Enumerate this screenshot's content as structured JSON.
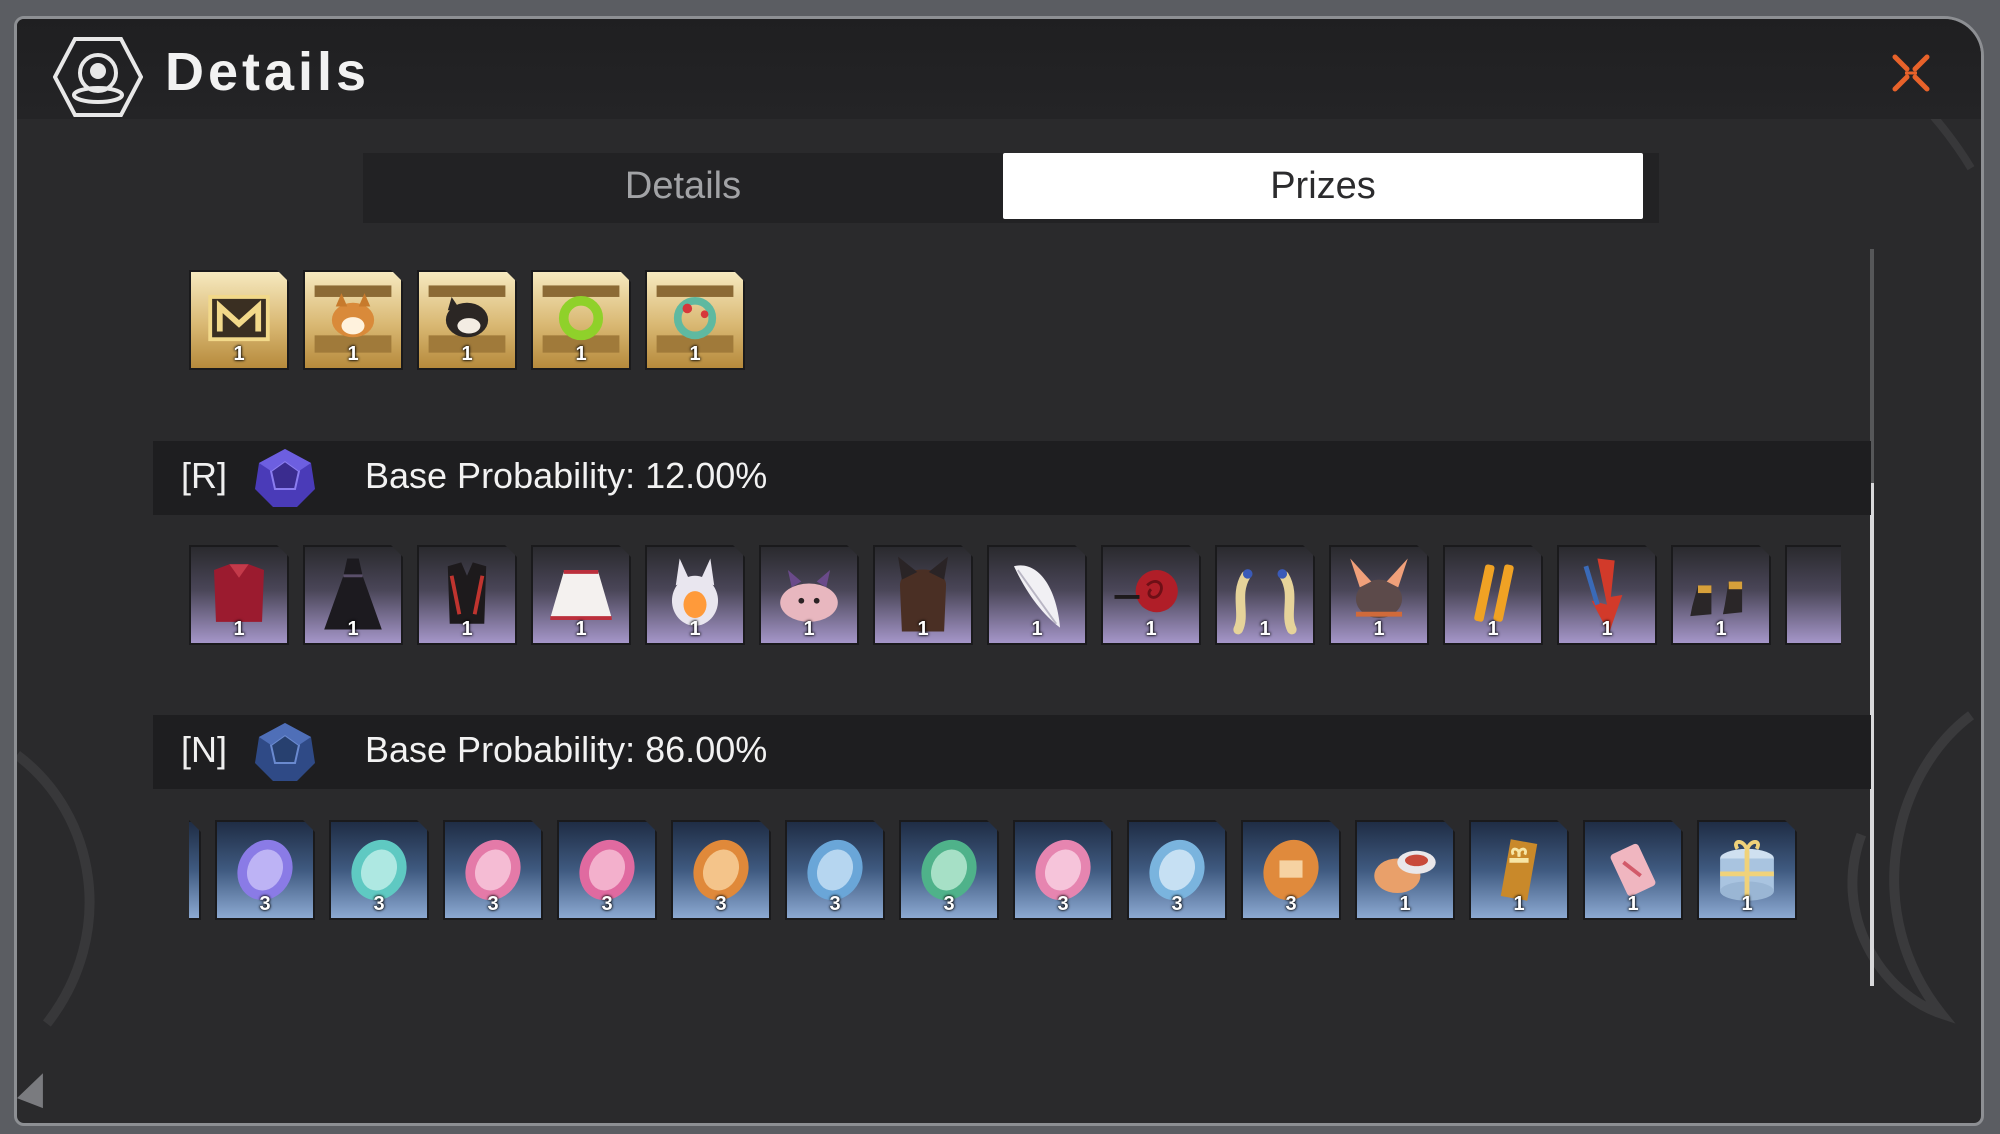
{
  "header": {
    "title": "Details"
  },
  "tabs": [
    {
      "label": "Details",
      "active": false
    },
    {
      "label": "Prizes",
      "active": true
    }
  ],
  "top_row": {
    "items": [
      {
        "name": "medal-box",
        "qty": "1"
      },
      {
        "name": "corgi-box",
        "qty": "1"
      },
      {
        "name": "black-dog-box",
        "qty": "1"
      },
      {
        "name": "green-wreath-box",
        "qty": "1"
      },
      {
        "name": "red-wreath-box",
        "qty": "1"
      }
    ]
  },
  "r_section": {
    "rarity": "[R]",
    "probability_text": "Base Probability: 12.00%",
    "items": [
      {
        "name": "red-top",
        "qty": "1"
      },
      {
        "name": "black-dress",
        "qty": "1"
      },
      {
        "name": "black-red-vest",
        "qty": "1"
      },
      {
        "name": "white-skirt",
        "qty": "1"
      },
      {
        "name": "fox-hood",
        "qty": "1"
      },
      {
        "name": "pig-plush",
        "qty": "1"
      },
      {
        "name": "cat-ear-wig",
        "qty": "1"
      },
      {
        "name": "white-feather",
        "qty": "1"
      },
      {
        "name": "red-rose",
        "qty": "1"
      },
      {
        "name": "blonde-twintails",
        "qty": "1"
      },
      {
        "name": "bunny-hat",
        "qty": "1"
      },
      {
        "name": "orange-pins",
        "qty": "1"
      },
      {
        "name": "red-arrow-ornament",
        "qty": "1"
      },
      {
        "name": "black-boots",
        "qty": "1"
      }
    ]
  },
  "n_section": {
    "rarity": "[N]",
    "probability_text": "Base Probability: 86.00%",
    "items": [
      {
        "name": "purple-token",
        "qty": "3"
      },
      {
        "name": "aqua-token",
        "qty": "3"
      },
      {
        "name": "pink-token",
        "qty": "3"
      },
      {
        "name": "pink-token-2",
        "qty": "3"
      },
      {
        "name": "orange-token",
        "qty": "3"
      },
      {
        "name": "blue-token",
        "qty": "3"
      },
      {
        "name": "green-token",
        "qty": "3"
      },
      {
        "name": "pink-token-3",
        "qty": "3"
      },
      {
        "name": "light-blue-token",
        "qty": "3"
      },
      {
        "name": "orange-book-token",
        "qty": "3"
      },
      {
        "name": "cream-tin",
        "qty": "1"
      },
      {
        "name": "gold-gift-box",
        "qty": "1"
      },
      {
        "name": "pink-candy",
        "qty": "1"
      },
      {
        "name": "blue-gift-box",
        "qty": "1"
      }
    ]
  },
  "colors": {
    "accent_close": "#e8622a",
    "gold_tile": "#d9b873",
    "purple_tile": "#a596c9",
    "blue_tile": "#8ca9d2",
    "r_gem": "#5b4bd0",
    "n_gem": "#3f5a9a"
  },
  "icons": {
    "logo": "gacha-emblem-icon",
    "close": "close-x-icon",
    "r_gem": "purple-d12-gem-icon",
    "n_gem": "blue-d12-gem-icon"
  }
}
